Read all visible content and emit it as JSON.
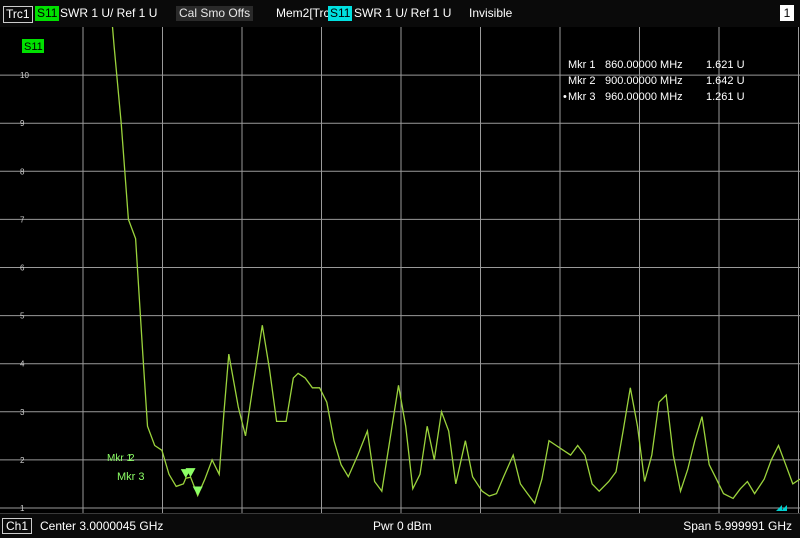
{
  "header": {
    "trace_label": "Trc1",
    "trace_param": "S11",
    "trace_format": "SWR  1 U/  Ref 1 U",
    "trace_flags": "Cal Smo Offs",
    "mem_label": "Mem2[Trc1]",
    "mem_param": "S11",
    "mem_format": "SWR  1 U/  Ref 1 U",
    "mem_state": "Invisible",
    "window_number": "1"
  },
  "footer": {
    "channel_label": "Ch1",
    "center": "Center  3.0000045 GHz",
    "power": "Pwr  0 dBm",
    "span": "Span  5.999991 GHz"
  },
  "plot_badge": "S11",
  "marker_table": [
    {
      "name": "Mkr 1",
      "freq": "860.00000 MHz",
      "value": "1.621 U",
      "active": false
    },
    {
      "name": "Mkr 2",
      "freq": "900.00000 MHz",
      "value": "1.642 U",
      "active": false
    },
    {
      "name": "Mkr 3",
      "freq": "960.00000 MHz",
      "value": "1.261 U",
      "active": true
    }
  ],
  "marker_tags": {
    "m1": "Mkr 1",
    "m2": "2",
    "m3": "Mkr 3"
  },
  "colors": {
    "trace": "#9bd33c",
    "grid": "#9a9a9a",
    "marker": "#8cff66",
    "s11_badge": "#00e000",
    "mem_badge": "#00e0e0"
  },
  "chart_data": {
    "type": "line",
    "xlabel": "",
    "ylabel": "",
    "x_unit": "GHz",
    "xlim": [
      9e-06,
      6.0
    ],
    "ylim": [
      1,
      11
    ],
    "y_ticks": [
      1,
      2,
      3,
      4,
      5,
      6,
      7,
      8,
      9,
      10
    ],
    "grid": true,
    "series": [
      {
        "x": [
          0.0,
          0.22,
          0.26,
          0.32,
          0.38,
          0.44,
          0.5,
          0.54,
          0.6,
          0.66,
          0.72,
          0.78,
          0.84,
          0.86,
          0.9,
          0.96,
          1.02,
          1.08,
          1.14,
          1.18,
          1.22,
          1.3,
          1.36,
          1.42,
          1.5,
          1.56,
          1.62,
          1.7,
          1.76,
          1.8,
          1.86,
          1.92,
          1.98,
          2.04,
          2.1,
          2.16,
          2.22,
          2.3,
          2.38,
          2.44,
          2.5,
          2.58,
          2.64,
          2.7,
          2.76,
          2.82,
          2.88,
          2.94,
          3.0,
          3.06,
          3.12,
          3.2,
          3.26,
          3.34,
          3.4,
          3.46,
          3.52,
          3.6,
          3.66,
          3.72,
          3.78,
          3.84,
          3.9,
          3.96,
          4.02,
          4.08,
          4.14,
          4.2,
          4.26,
          4.32,
          4.4,
          4.46,
          4.52,
          4.58,
          4.64,
          4.7,
          4.76,
          4.82,
          4.88,
          4.94,
          5.0,
          5.06,
          5.12,
          5.18,
          5.24,
          5.3,
          5.36,
          5.44,
          5.5,
          5.56,
          5.62,
          5.7,
          5.76,
          5.82,
          5.88,
          5.94,
          6.0
        ],
        "y": [
          13.5,
          11.8,
          10.6,
          9.0,
          7.0,
          6.6,
          4.2,
          2.7,
          2.3,
          2.2,
          1.7,
          1.45,
          1.5,
          1.62,
          1.64,
          1.26,
          1.6,
          2.0,
          1.7,
          3.0,
          4.2,
          3.1,
          2.5,
          3.5,
          4.8,
          3.9,
          2.8,
          2.8,
          3.7,
          3.8,
          3.7,
          3.5,
          3.5,
          3.2,
          2.4,
          1.9,
          1.65,
          2.1,
          2.6,
          1.55,
          1.35,
          2.6,
          3.55,
          2.7,
          1.4,
          1.7,
          2.7,
          2.0,
          3.0,
          2.6,
          1.5,
          2.4,
          1.65,
          1.35,
          1.25,
          1.3,
          1.65,
          2.1,
          1.5,
          1.3,
          1.1,
          1.6,
          2.4,
          2.3,
          2.2,
          2.1,
          2.3,
          2.1,
          1.5,
          1.35,
          1.55,
          1.75,
          2.6,
          3.5,
          2.7,
          1.55,
          2.1,
          3.2,
          3.35,
          2.1,
          1.35,
          1.8,
          2.4,
          2.9,
          1.9,
          1.6,
          1.3,
          1.2,
          1.4,
          1.55,
          1.3,
          1.6,
          2.0,
          2.3,
          1.9,
          1.5,
          1.6
        ]
      }
    ],
    "markers": [
      {
        "label": "Mkr 1",
        "x": 0.86,
        "y": 1.621
      },
      {
        "label": "Mkr 2",
        "x": 0.9,
        "y": 1.642
      },
      {
        "label": "Mkr 3",
        "x": 0.96,
        "y": 1.261
      }
    ]
  }
}
